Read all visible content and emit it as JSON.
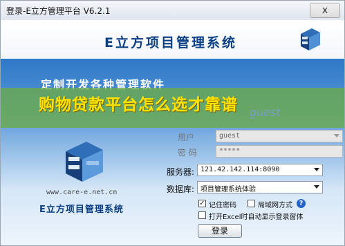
{
  "window": {
    "title": "登录-E立方管理平台 V6.2.1",
    "close_label": "x"
  },
  "banner": {
    "title": "E立方项目管理系统"
  },
  "slogan": "定制开发各种管理软件",
  "overlay": {
    "text": "购物贷款平台怎么选才靠谱"
  },
  "watermark": "guest",
  "logo": {
    "url": "www.care-e.net.cn",
    "product_name": "E立方项目管理系统"
  },
  "form": {
    "user": {
      "label": "用户",
      "value": "guest"
    },
    "password": {
      "label": "密 码",
      "value": "*****"
    },
    "server": {
      "label": "服务器:",
      "value": "121.42.142.114:8090"
    },
    "database": {
      "label": "数据库:",
      "value": "项目管理系统体验"
    },
    "remember": {
      "label": "记住密码",
      "checked": "✓"
    },
    "lan": {
      "label": "局域网方式"
    },
    "help_glyph": "?",
    "excel": {
      "label": "打开Excel时自动显示登录窗体"
    },
    "login_label": "登录"
  }
}
